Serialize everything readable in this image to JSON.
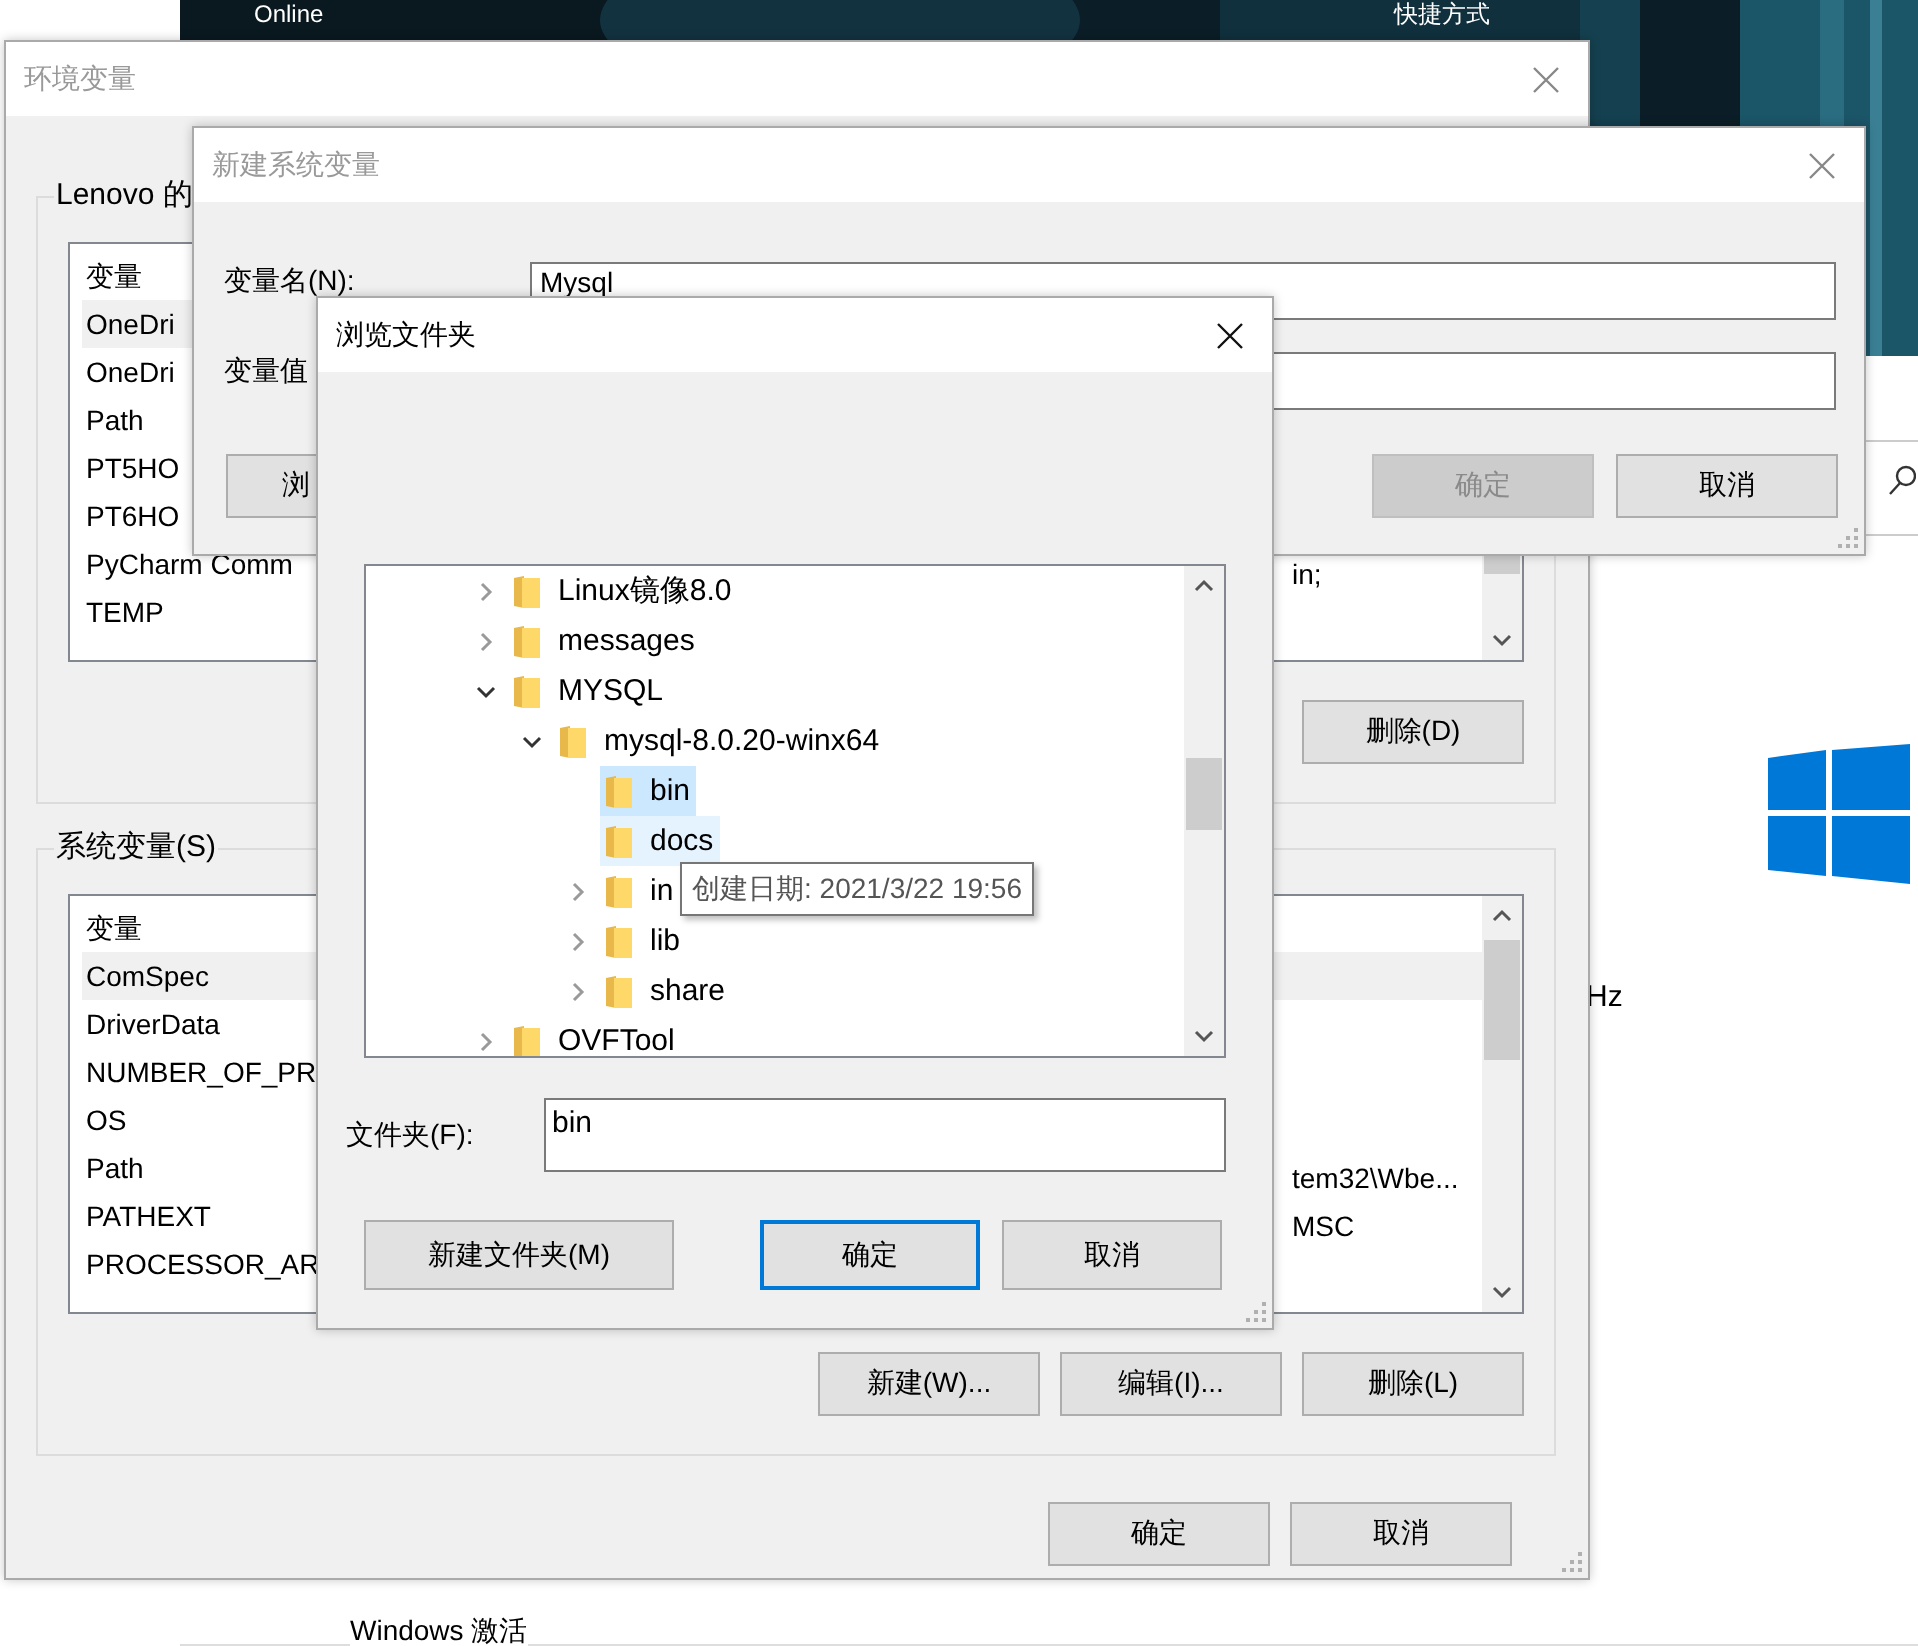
{
  "desktop": {
    "top_texts": [
      "Online",
      "快捷方式"
    ],
    "side_text": "Hz",
    "bottom_text": "Windows 激活"
  },
  "env_window": {
    "title": "环境变量",
    "groups": [
      {
        "legend": "Lenovo 的",
        "column": "变量",
        "rows": [
          {
            "name": "OneDri",
            "selected": true
          },
          {
            "name": "OneDri",
            "selected": false
          },
          {
            "name": "Path",
            "selected": false
          },
          {
            "name": "PT5HO",
            "selected": false
          },
          {
            "name": "PT6HO",
            "selected": false
          },
          {
            "name": "PyCharm Comm",
            "value": "in;",
            "selected": false
          },
          {
            "name": "TEMP",
            "selected": false
          }
        ],
        "buttons": [
          "删除(D)"
        ]
      },
      {
        "legend": "系统变量(S)",
        "column": "变量",
        "rows": [
          {
            "name": "ComSpec",
            "selected": true
          },
          {
            "name": "DriverData",
            "selected": false
          },
          {
            "name": "NUMBER_OF_PR",
            "selected": false
          },
          {
            "name": "OS",
            "selected": false
          },
          {
            "name": "Path",
            "value": "tem32\\Wbe...",
            "selected": false
          },
          {
            "name": "PATHEXT",
            "value": "MSC",
            "selected": false
          },
          {
            "name": "PROCESSOR_AR",
            "selected": false
          }
        ],
        "buttons": [
          "新建(W)...",
          "编辑(I)...",
          "删除(L)"
        ]
      }
    ],
    "buttons": [
      "确定",
      "取消"
    ]
  },
  "new_var_window": {
    "title": "新建系统变量",
    "fields": [
      {
        "label": "变量名(N):",
        "value": "Mysql"
      },
      {
        "label": "变量值"
      }
    ],
    "buttons": [
      {
        "label": "浏",
        "disabled": false
      },
      {
        "label": "确定",
        "disabled": true
      },
      {
        "label": "取消",
        "disabled": false
      }
    ]
  },
  "browse_window": {
    "title": "浏览文件夹",
    "tree": [
      {
        "label": "Linux镜像8.0",
        "expandable": true,
        "expanded": false,
        "selected": false,
        "hovered": false
      },
      {
        "label": "messages",
        "expandable": true,
        "expanded": false,
        "selected": false,
        "hovered": false
      },
      {
        "label": "MYSQL",
        "expandable": true,
        "expanded": true,
        "selected": false,
        "hovered": false,
        "children": [
          {
            "label": "mysql-8.0.20-winx64",
            "expandable": true,
            "expanded": true,
            "selected": false,
            "hovered": false,
            "children": [
              {
                "label": "bin",
                "expandable": false,
                "selected": true,
                "hovered": false
              },
              {
                "label": "docs",
                "expandable": false,
                "selected": false,
                "hovered": true
              },
              {
                "label": "in",
                "expandable": true,
                "expanded": false,
                "selected": false,
                "hovered": false
              },
              {
                "label": "lib",
                "expandable": true,
                "expanded": false,
                "selected": false,
                "hovered": false
              },
              {
                "label": "share",
                "expandable": true,
                "expanded": false,
                "selected": false,
                "hovered": false
              }
            ]
          }
        ]
      },
      {
        "label": "OVFTool",
        "expandable": true,
        "expanded": false,
        "selected": false,
        "hovered": false
      }
    ],
    "folder_field": {
      "label": "文件夹(F):",
      "value": "bin"
    },
    "buttons": [
      {
        "label": "新建文件夹(M)",
        "focused": false
      },
      {
        "label": "确定",
        "focused": true
      },
      {
        "label": "取消",
        "focused": false
      }
    ]
  },
  "tooltip": {
    "text": "创建日期: 2021/3/22 19:56"
  }
}
